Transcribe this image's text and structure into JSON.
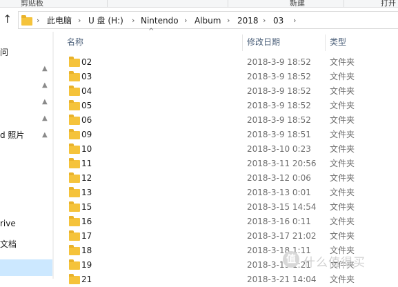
{
  "ribbon": {
    "left_label": "剪贴板",
    "mid_label": "新建",
    "right_label": "打开"
  },
  "address": {
    "crumbs": [
      "此电脑",
      "U 盘 (H:)",
      "Nintendo",
      "Album",
      "2018",
      "03"
    ]
  },
  "nav": {
    "items": [
      "问",
      "",
      "",
      "",
      "d 照片",
      "rive",
      "文档",
      ""
    ]
  },
  "columns": {
    "name": "名称",
    "date": "修改日期",
    "type": "类型"
  },
  "rows": [
    {
      "name": "02",
      "date": "2018-3-9 18:52",
      "type": "文件夹"
    },
    {
      "name": "03",
      "date": "2018-3-9 18:52",
      "type": "文件夹"
    },
    {
      "name": "04",
      "date": "2018-3-9 18:52",
      "type": "文件夹"
    },
    {
      "name": "05",
      "date": "2018-3-9 18:52",
      "type": "文件夹"
    },
    {
      "name": "06",
      "date": "2018-3-9 18:52",
      "type": "文件夹"
    },
    {
      "name": "09",
      "date": "2018-3-9 18:51",
      "type": "文件夹"
    },
    {
      "name": "10",
      "date": "2018-3-10 0:23",
      "type": "文件夹"
    },
    {
      "name": "11",
      "date": "2018-3-11 20:56",
      "type": "文件夹"
    },
    {
      "name": "12",
      "date": "2018-3-12 0:06",
      "type": "文件夹"
    },
    {
      "name": "13",
      "date": "2018-3-13 0:01",
      "type": "文件夹"
    },
    {
      "name": "15",
      "date": "2018-3-15 14:54",
      "type": "文件夹"
    },
    {
      "name": "16",
      "date": "2018-3-16 0:11",
      "type": "文件夹"
    },
    {
      "name": "17",
      "date": "2018-3-17 21:02",
      "type": "文件夹"
    },
    {
      "name": "18",
      "date": "2018-3-18 1:11",
      "type": "文件夹"
    },
    {
      "name": "19",
      "date": "2018-3-19 1:21",
      "type": "文件夹"
    },
    {
      "name": "21",
      "date": "2018-3-21 14:04",
      "type": "文件夹"
    }
  ],
  "watermark": {
    "badge": "值",
    "text": "什么值得买"
  },
  "colors": {
    "folder": "#f5c33b",
    "header_text": "#4c607a",
    "selection": "#cce8ff"
  },
  "icons": [
    "back-arrow-icon",
    "folder-icon",
    "pin-icon",
    "sort-up-icon"
  ]
}
